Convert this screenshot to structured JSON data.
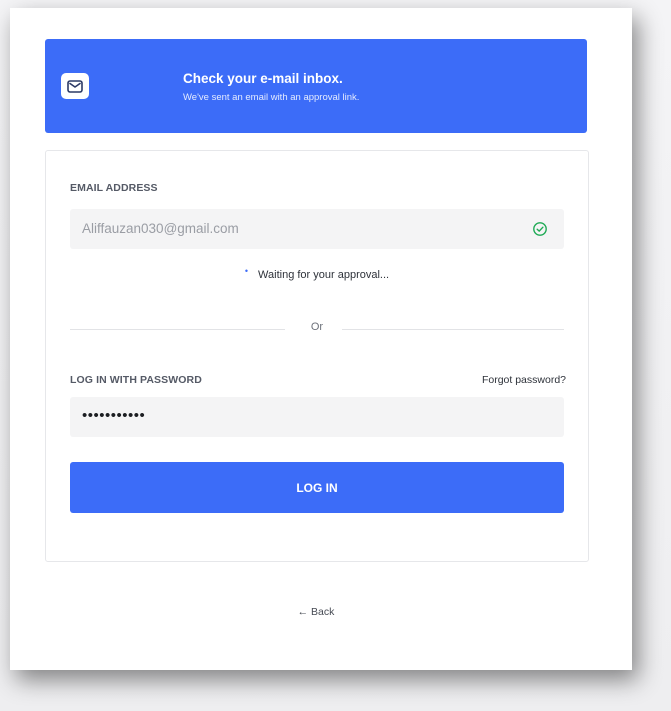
{
  "banner": {
    "title": "Check your e-mail inbox.",
    "subtitle": "We've sent an email with an approval link.",
    "icon": "mail-icon",
    "color": "#3c6cf8"
  },
  "email": {
    "label": "EMAIL ADDRESS",
    "value": "Aliffauzan030@gmail.com",
    "status_icon": "check-circle-icon",
    "status_color": "#1faa55"
  },
  "waiting": {
    "text": "Waiting for your approval..."
  },
  "divider": {
    "text": "Or"
  },
  "password": {
    "label": "LOG IN WITH PASSWORD",
    "forgot_label": "Forgot password?",
    "value": "•••••••••••"
  },
  "login_button": {
    "label": "LOG IN",
    "color": "#3c6cf8"
  },
  "back": {
    "label": "← Back"
  }
}
